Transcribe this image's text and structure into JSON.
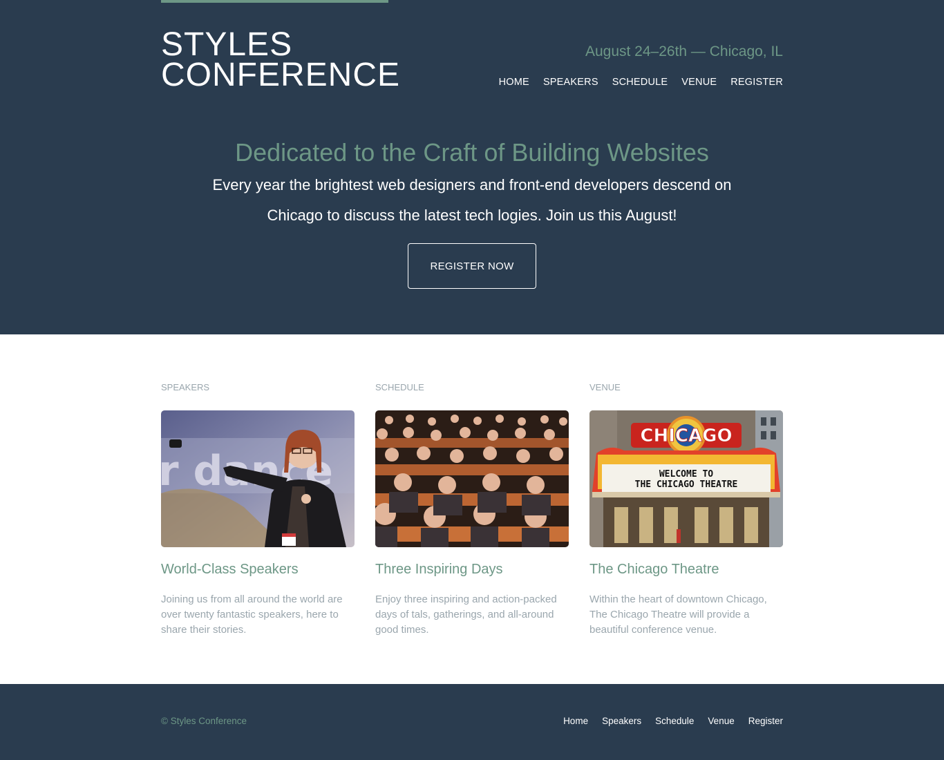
{
  "header": {
    "logo_line1": "STYLES",
    "logo_line2": "CONFERENCE",
    "tagline": "August 24–26th — Chicago, IL",
    "nav": [
      "HOME",
      "SPEAKERS",
      "SCHEDULE",
      "VENUE",
      "REGISTER"
    ]
  },
  "hero": {
    "title": "Dedicated to the Craft of Building Websites",
    "text": "Every year the brightest web designers and front-end developers descend on Chicago to discuss the latest tech logies. Join us this August!",
    "button": "REGISTER NOW"
  },
  "teasers": [
    {
      "label": "SPEAKERS",
      "title": "World-Class Speakers",
      "text": "Joining us from all around the world are over twenty fantastic speakers, here to share their stories.",
      "image": "speaker-photo"
    },
    {
      "label": "SCHEDULE",
      "title": "Three Inspiring Days",
      "text": "Enjoy three inspiring and action-packed days of tals, gatherings, and all-around good times.",
      "image": "audience-photo"
    },
    {
      "label": "VENUE",
      "title": "The Chicago Theatre",
      "text": "Within the heart of downtown Chicago, The Chicago Theatre will provide a beautiful conference venue.",
      "image": "theatre-photo",
      "sign_text": "CHICAGO",
      "marquee_line1": "WELCOME TO",
      "marquee_line2": "THE CHICAGO THEATRE"
    }
  ],
  "footer": {
    "copyright": "© Styles Conference",
    "nav": [
      "Home",
      "Speakers",
      "Schedule",
      "Venue",
      "Register"
    ]
  },
  "colors": {
    "primary": "#2a3c4f",
    "accent": "#6d9786",
    "muted": "#9aa6ad"
  }
}
